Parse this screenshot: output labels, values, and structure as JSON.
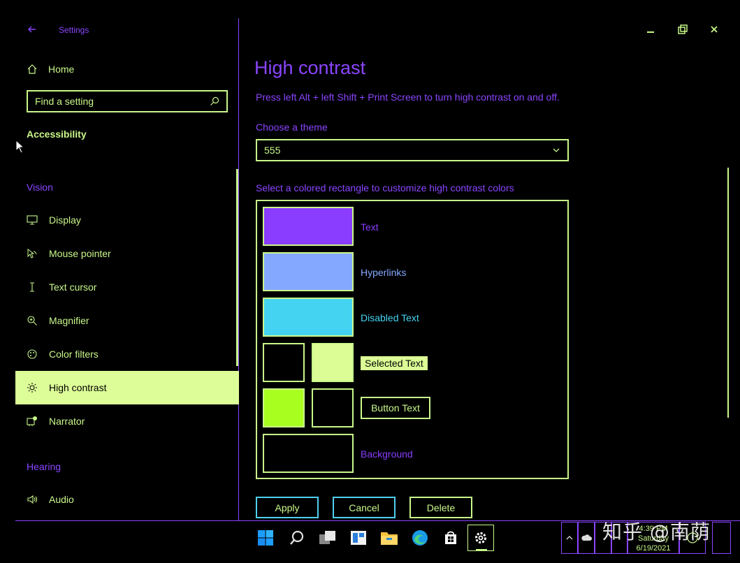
{
  "window": {
    "title": "Settings",
    "controls": [
      "minimize",
      "maximize",
      "close"
    ]
  },
  "sidebar": {
    "home": {
      "label": "Home",
      "icon": "home-icon"
    },
    "search": {
      "placeholder": "Find a setting",
      "icon": "search-icon"
    },
    "section": "Accessibility",
    "vision_group": "Vision",
    "items": [
      {
        "label": "Display",
        "icon": "monitor-icon"
      },
      {
        "label": "Mouse pointer",
        "icon": "mouse-pointer-icon"
      },
      {
        "label": "Text cursor",
        "icon": "text-cursor-icon"
      },
      {
        "label": "Magnifier",
        "icon": "magnifier-icon"
      },
      {
        "label": "Color filters",
        "icon": "color-filters-icon"
      },
      {
        "label": "High contrast",
        "icon": "sun-icon",
        "selected": true
      },
      {
        "label": "Narrator",
        "icon": "narrator-icon"
      }
    ],
    "hearing_group": "Hearing",
    "hearing_items": [
      {
        "label": "Audio",
        "icon": "speaker-icon"
      }
    ]
  },
  "main": {
    "title": "High contrast",
    "hint": "Press left Alt + left Shift + Print Screen to turn high contrast on and off.",
    "theme_label": "Choose a theme",
    "theme_value": "555",
    "colors_label": "Select a colored rectangle to customize high contrast colors",
    "colors": {
      "text": {
        "label": "Text",
        "color": "#8a3dff"
      },
      "hyperlinks": {
        "label": "Hyperlinks",
        "color": "#84a8ff"
      },
      "disabled_text": {
        "label": "Disabled Text",
        "color": "#44d4f2"
      },
      "selected_text": {
        "label": "Selected Text",
        "fg": "#000000",
        "bg": "#dcfd96"
      },
      "button_text": {
        "label": "Button Text",
        "fg": "#a8ff1f",
        "bg": "#000000"
      },
      "background": {
        "label": "Background",
        "color": "#000000"
      }
    },
    "buttons": {
      "apply": "Apply",
      "cancel": "Cancel",
      "delete": "Delete"
    }
  },
  "theme_colors": {
    "accent_purple": "#8a45ff",
    "accent_green": "#c9f88a",
    "selection_bg": "#ddfd98",
    "cyan": "#4fcff0"
  },
  "taskbar": {
    "apps": [
      "windows-start-icon",
      "search-icon",
      "task-view-icon",
      "widgets-icon",
      "file-explorer-icon",
      "edge-icon",
      "store-icon",
      "settings-icon"
    ],
    "tray_icons": [
      "chevron-up-icon",
      "cloud-icon"
    ],
    "clock": {
      "time": "4:39 PM",
      "day": "Saturday",
      "date": "6/19/2021"
    }
  },
  "watermark": "知乎 @南荫"
}
